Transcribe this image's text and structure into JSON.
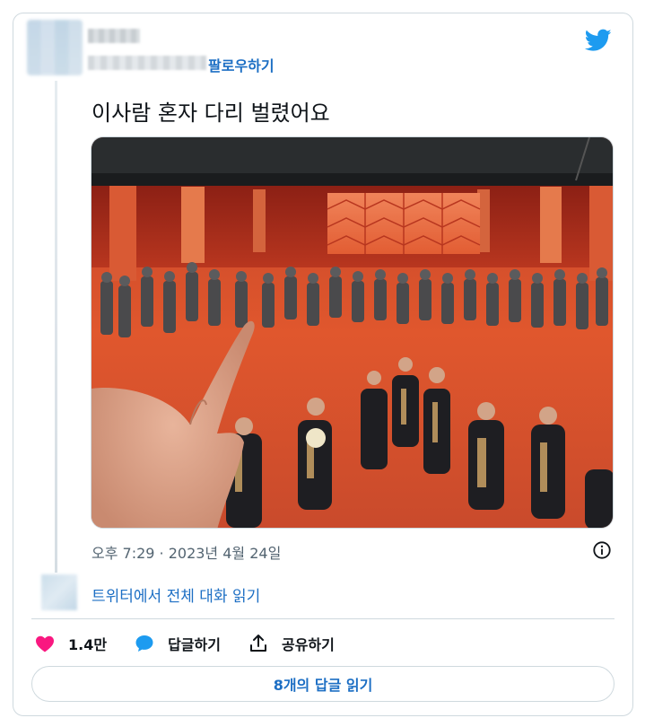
{
  "header": {
    "follow_label": "팔로우하기"
  },
  "tweet": {
    "text": "이사람 혼자 다리 벌렸어요",
    "timestamp": "오후 7:29 · 2023년 4월 24일"
  },
  "conversation": {
    "read_label": "트위터에서 전체 대화 읽기"
  },
  "actions": {
    "likes_count": "1.4만",
    "reply_label": "답글하기",
    "share_label": "공유하기"
  },
  "replies_button": {
    "label": "8개의 답글 읽기"
  },
  "colors": {
    "link_blue": "#1d6fc4",
    "twitter_blue": "#1d9bf0",
    "like_pink": "#f91880",
    "border": "#cfd9de"
  },
  "icons": {
    "brand": "twitter-bird-icon",
    "info": "info-icon",
    "like": "heart-icon",
    "reply": "speech-bubble-icon",
    "share": "share-arrow-icon"
  }
}
